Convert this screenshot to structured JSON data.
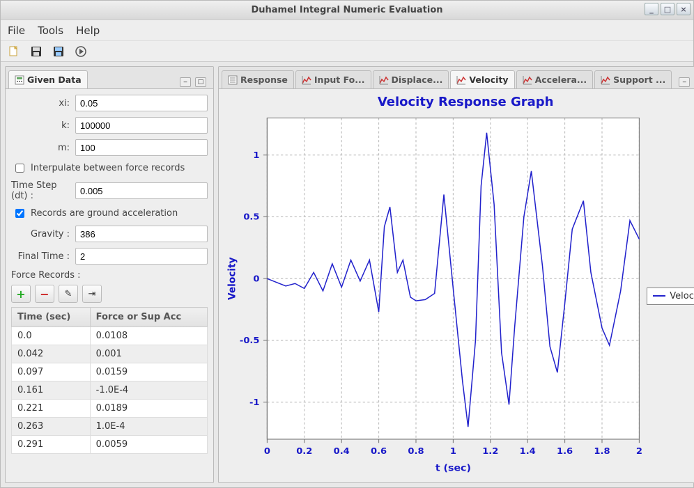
{
  "window": {
    "title": "Duhamel Integral Numeric Evaluation"
  },
  "menubar": {
    "file": "File",
    "tools": "Tools",
    "help": "Help"
  },
  "left_panel": {
    "tab_label": "Given Data",
    "fields": {
      "xi_label": "xi:",
      "xi_value": "0.05",
      "k_label": "k:",
      "k_value": "100000",
      "m_label": "m:",
      "m_value": "100",
      "interp_label": "Interpulate between force records",
      "interp_checked": false,
      "dt_label": "Time Step (dt) :",
      "dt_value": "0.005",
      "ground_label": "Records are ground acceleration",
      "ground_checked": true,
      "gravity_label": "Gravity :",
      "gravity_value": "386",
      "final_time_label": "Final Time :",
      "final_time_value": "2"
    },
    "records_label": "Force Records :",
    "records_header_time": "Time (sec)",
    "records_header_force": "Force or Sup Acc",
    "records": [
      {
        "t": "0.0",
        "f": "0.0108"
      },
      {
        "t": "0.042",
        "f": "0.001"
      },
      {
        "t": "0.097",
        "f": "0.0159"
      },
      {
        "t": "0.161",
        "f": "-1.0E-4"
      },
      {
        "t": "0.221",
        "f": "0.0189"
      },
      {
        "t": "0.263",
        "f": "1.0E-4"
      },
      {
        "t": "0.291",
        "f": "0.0059"
      }
    ]
  },
  "right_panel": {
    "tabs": [
      {
        "label": "Response"
      },
      {
        "label": "Input Fo..."
      },
      {
        "label": "Displace..."
      },
      {
        "label": "Velocity"
      },
      {
        "label": "Accelera..."
      },
      {
        "label": "Support ..."
      }
    ],
    "active_tab": 3,
    "legend_label": "Velocity"
  },
  "chart_data": {
    "type": "line",
    "title": "Velocity Response Graph",
    "xlabel": "t (sec)",
    "ylabel": "Velocity",
    "xlim": [
      0,
      2
    ],
    "ylim": [
      -1.3,
      1.3
    ],
    "xticks": [
      0,
      0.2,
      0.4,
      0.6,
      0.8,
      1,
      1.2,
      1.4,
      1.6,
      1.8,
      2
    ],
    "yticks": [
      -1,
      -0.5,
      0,
      0.5,
      1
    ],
    "series": [
      {
        "name": "Velocity",
        "x": [
          0.0,
          0.05,
          0.1,
          0.15,
          0.2,
          0.25,
          0.3,
          0.35,
          0.4,
          0.45,
          0.5,
          0.55,
          0.6,
          0.63,
          0.66,
          0.7,
          0.73,
          0.77,
          0.8,
          0.85,
          0.9,
          0.95,
          1.0,
          1.05,
          1.08,
          1.12,
          1.15,
          1.18,
          1.22,
          1.26,
          1.3,
          1.33,
          1.38,
          1.42,
          1.48,
          1.52,
          1.56,
          1.6,
          1.64,
          1.7,
          1.74,
          1.8,
          1.84,
          1.9,
          1.95,
          2.0
        ],
        "y": [
          0.0,
          -0.03,
          -0.06,
          -0.04,
          -0.08,
          0.05,
          -0.1,
          0.12,
          -0.07,
          0.15,
          -0.02,
          0.15,
          -0.27,
          0.42,
          0.58,
          0.05,
          0.15,
          -0.15,
          -0.18,
          -0.17,
          -0.12,
          0.68,
          -0.08,
          -0.83,
          -1.2,
          -0.5,
          0.75,
          1.18,
          0.6,
          -0.6,
          -1.02,
          -0.4,
          0.5,
          0.87,
          0.1,
          -0.55,
          -0.76,
          -0.2,
          0.4,
          0.63,
          0.05,
          -0.4,
          -0.54,
          -0.1,
          0.47,
          0.32
        ]
      }
    ]
  }
}
